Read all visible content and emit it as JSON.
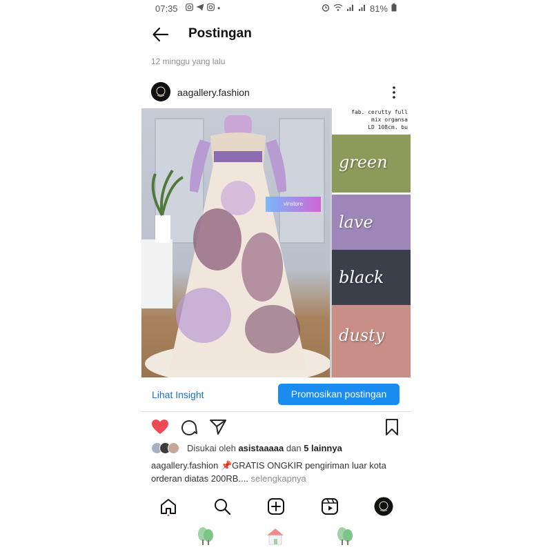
{
  "status_bar": {
    "time": "07:35",
    "battery": "81%",
    "left_icons": [
      "instagram-icon",
      "telegram-icon",
      "instagram-icon",
      "dot-icon"
    ],
    "right_icons": [
      "alarm-icon",
      "wifi-icon",
      "signal-icon",
      "signal-icon",
      "battery-icon"
    ]
  },
  "header": {
    "title": "Postingan"
  },
  "post": {
    "time_ago": "12 minggu yang lalu",
    "username": "aagallery.fashion",
    "image": {
      "watermark": "vinstore",
      "fabric_lines": [
        "fab. cerutty full",
        "mix organsa",
        "LD 108cm. bu"
      ],
      "colors": [
        {
          "label": "green",
          "hex": "#8c9a5a"
        },
        {
          "label": "lave",
          "hex": "#9e86b8"
        },
        {
          "label": "black",
          "hex": "#3a3f4a"
        },
        {
          "label": "dusty",
          "hex": "#c98e86"
        }
      ]
    },
    "insight_link": "Lihat Insight",
    "promote_button": "Promosikan postingan",
    "likes": {
      "prefix": "Disukai oleh",
      "user": "asistaaaaa",
      "middle": "dan",
      "others": "5 lainnya"
    },
    "caption": {
      "user": "aagallery.fashion",
      "pin": "📌",
      "text": "GRATIS ONGKIR pengiriman luar kota orderan diatas 200RB....",
      "more": "selengkapnya"
    }
  },
  "colors": {
    "like_red": "#ed4956",
    "link_blue": "#1a73c7",
    "button_blue": "#1a8cf0"
  }
}
